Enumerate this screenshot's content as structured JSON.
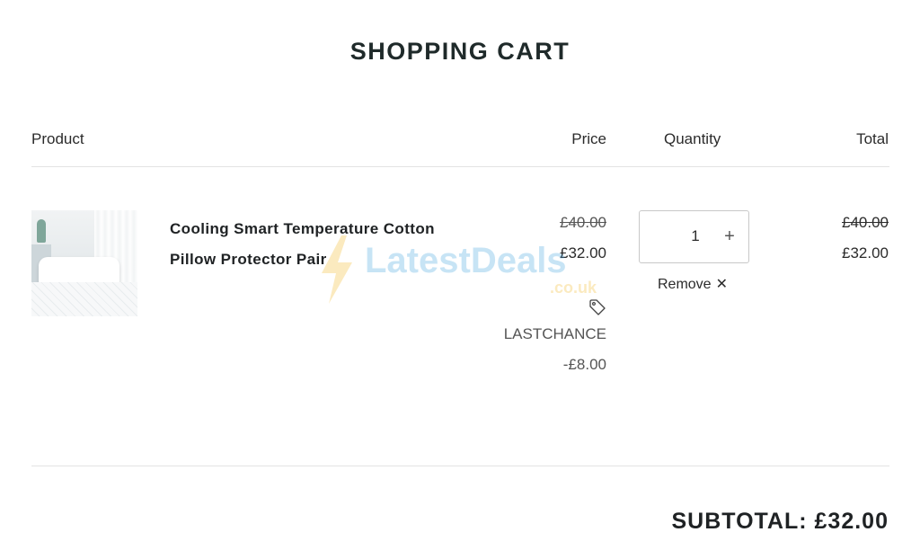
{
  "page": {
    "title": "SHOPPING CART"
  },
  "table": {
    "headers": {
      "product": "Product",
      "price": "Price",
      "quantity": "Quantity",
      "total": "Total"
    }
  },
  "item": {
    "name_line1": "Cooling Smart Temperature Cotton",
    "name_line2": "Pillow Protector Pair",
    "price_original": "£40.00",
    "price_sale": "£32.00",
    "discount_icon": "tag-icon",
    "discount_code": "LASTCHANCE",
    "discount_amount": "-£8.00",
    "quantity": "1",
    "plus_label": "+",
    "remove_label": "Remove",
    "remove_icon": "close-icon",
    "total_original": "£40.00",
    "total_sale": "£32.00"
  },
  "summary": {
    "subtotal_label": "SUBTOTAL: £32.00"
  },
  "watermark": {
    "text": "LatestDeals",
    "sub": ".co.uk"
  },
  "colors": {
    "text": "#1f2224",
    "divider": "#e3e3e3",
    "border": "#c8c8c8",
    "watermark_blue": "#3aa0de",
    "watermark_yellow": "#f2b51c"
  }
}
